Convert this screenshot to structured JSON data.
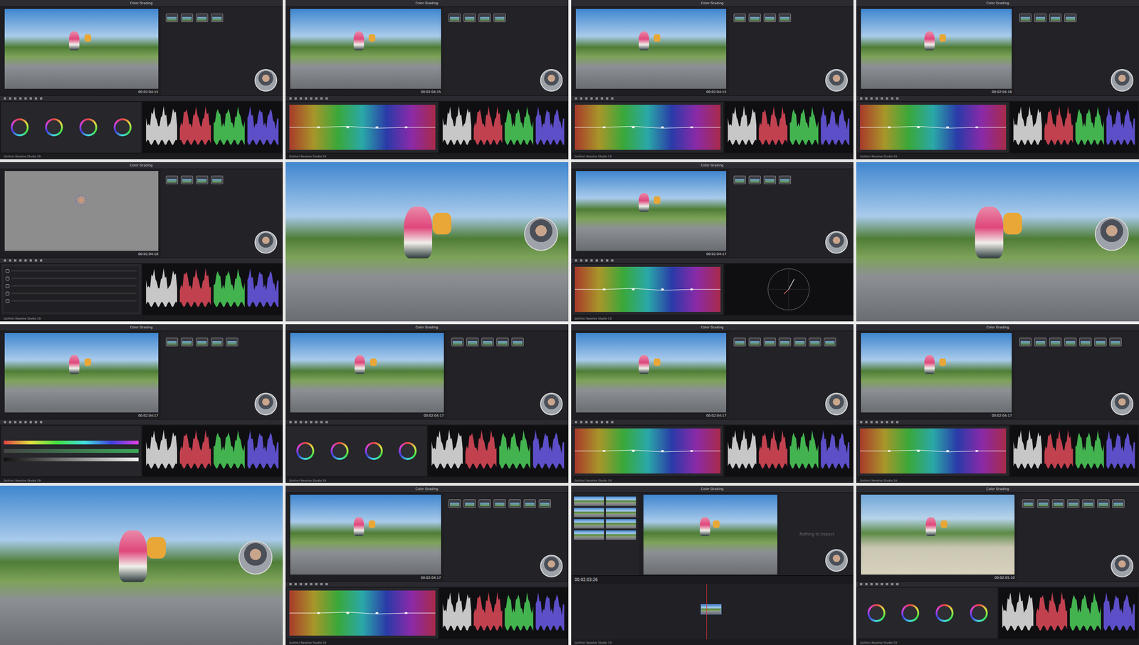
{
  "app": {
    "title": "Color Grading",
    "footer": "DaVinci Resolve Studio 19"
  },
  "inspector": "Nothing to inspect",
  "tiles": [
    {
      "kind": "resolve",
      "viewer": "ride",
      "nodes": 4,
      "panel": "wheels",
      "scope": "parade",
      "timecode": "00:02:04:15"
    },
    {
      "kind": "resolve",
      "viewer": "ride",
      "nodes": 4,
      "panel": "curves",
      "scope": "parade",
      "timecode": "00:02:04:15"
    },
    {
      "kind": "resolve",
      "viewer": "ride",
      "nodes": 4,
      "panel": "curves",
      "scope": "parade",
      "timecode": "00:02:04:15"
    },
    {
      "kind": "resolve",
      "viewer": "ride",
      "nodes": 4,
      "panel": "curves",
      "scope": "parade",
      "timecode": "00:02:04:16"
    },
    {
      "kind": "resolve",
      "viewer": "matte",
      "nodes": 4,
      "panel": "window",
      "scope": "parade",
      "timecode": "00:02:04:16"
    },
    {
      "kind": "frame",
      "viewer": "ride"
    },
    {
      "kind": "resolve",
      "viewer": "ride",
      "nodes": 4,
      "panel": "curves",
      "scope": "vectorscope",
      "timecode": "00:02:04:17"
    },
    {
      "kind": "frame",
      "viewer": "ride"
    },
    {
      "kind": "resolve",
      "viewer": "ride",
      "nodes": 5,
      "panel": "qualifier",
      "scope": "parade",
      "timecode": "00:02:04:17"
    },
    {
      "kind": "resolve",
      "viewer": "ride",
      "nodes": 5,
      "panel": "wheels",
      "scope": "parade",
      "timecode": "00:02:04:17"
    },
    {
      "kind": "resolve",
      "viewer": "ride",
      "nodes": 7,
      "panel": "curves",
      "scope": "parade",
      "timecode": "00:02:04:17"
    },
    {
      "kind": "resolve",
      "viewer": "ride",
      "nodes": 7,
      "panel": "curves",
      "scope": "parade",
      "timecode": "00:02:04:17"
    },
    {
      "kind": "frame",
      "viewer": "ride"
    },
    {
      "kind": "resolve",
      "viewer": "ride",
      "nodes": 7,
      "panel": "curves",
      "scope": "parade",
      "timecode": "00:02:04:17"
    },
    {
      "kind": "edit",
      "viewer": "ride",
      "timecode": "00:02:03:26"
    },
    {
      "kind": "resolve",
      "viewer": "scene2",
      "nodes": 7,
      "panel": "wheels",
      "scope": "parade",
      "timecode": "00:02:05:10"
    }
  ]
}
